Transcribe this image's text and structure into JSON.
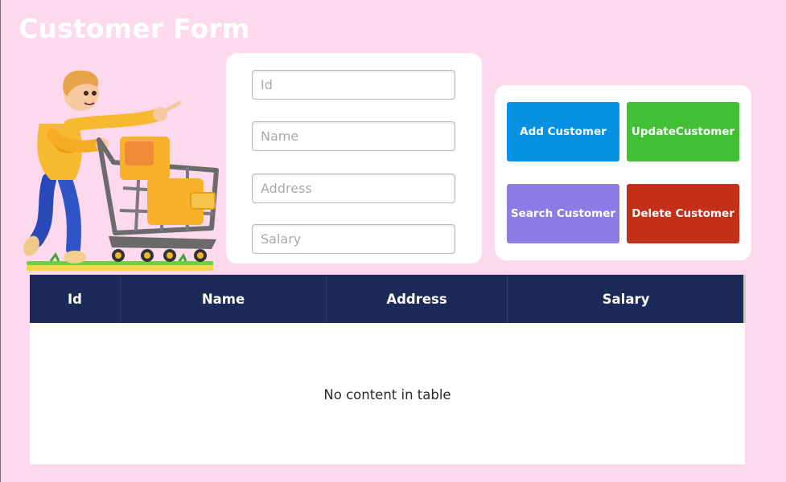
{
  "page": {
    "title": "Customer Form"
  },
  "form": {
    "id_placeholder": "Id",
    "name_placeholder": "Name",
    "address_placeholder": "Address",
    "salary_placeholder": "Salary",
    "id_value": "",
    "name_value": "",
    "address_value": "",
    "salary_value": ""
  },
  "buttons": {
    "add": "Add Customer",
    "update": "UpdateCustomer",
    "search": "Search Customer",
    "delete": "Delete Customer"
  },
  "colors": {
    "background": "#fcd9ec",
    "add": "#0791e3",
    "update": "#41bf35",
    "search": "#8e7ce6",
    "delete": "#c42f19",
    "table_header": "#1b2a58"
  },
  "table": {
    "columns": [
      "Id",
      "Name",
      "Address",
      "Salary"
    ],
    "rows": [],
    "empty_text": "No content in table"
  },
  "illustration": {
    "icon": "shopping-cart-person-icon"
  }
}
